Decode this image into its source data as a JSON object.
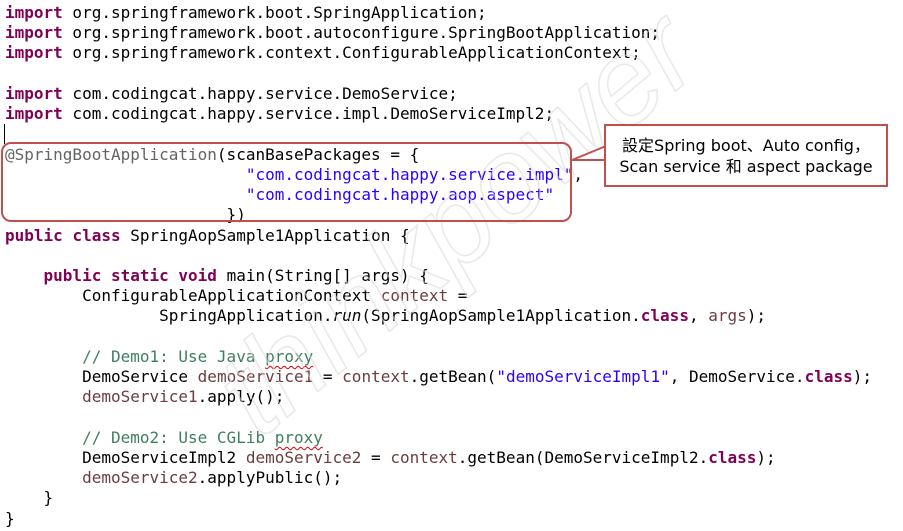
{
  "code": {
    "l1": {
      "kw": "import",
      "rest": " org.springframework.boot.SpringApplication;"
    },
    "l2": {
      "kw": "import",
      "rest": " org.springframework.boot.autoconfigure.SpringBootApplication;"
    },
    "l3": {
      "kw": "import",
      "rest": " org.springframework.context.ConfigurableApplicationContext;"
    },
    "l5": {
      "kw": "import",
      "rest": " com.codingcat.happy.service.DemoService;"
    },
    "l6": {
      "kw": "import",
      "rest": " com.codingcat.happy.service.impl.DemoServiceImpl2;"
    },
    "l8": {
      "ann": "@SpringBootApplication",
      "rest": "(scanBasePackages = {"
    },
    "l9": {
      "indent": "                         ",
      "str": "\"com.codingcat.happy.service.impl\"",
      "rest": ","
    },
    "l10": {
      "indent": "                         ",
      "str": "\"com.codingcat.happy.aop.aspect\""
    },
    "l11": {
      "text": "                       })"
    },
    "l12": {
      "kw1": "public",
      "sp": " ",
      "kw2": "class",
      "rest": " SpringAopSample1Application {"
    },
    "l14": {
      "indent": "    ",
      "kw1": "public",
      "kw2": "static",
      "kw3": "void",
      "rest": " main(String[] args) {"
    },
    "l15": {
      "indent": "        ",
      "type": "ConfigurableApplicationContext",
      "var": "context",
      "rest": " ="
    },
    "l16": {
      "indent": "                ",
      "pre": "SpringApplication.",
      "method": "run",
      "mid": "(SpringAopSample1Application.",
      "kw": "class",
      "post": ", ",
      "var": "args",
      "end": ");"
    },
    "l18": {
      "indent": "        ",
      "pre": "// Demo1: Use Java ",
      "sq": "proxy"
    },
    "l19": {
      "indent": "        ",
      "type": "DemoService",
      "var": "demoService1",
      "mid1": " = ",
      "var2": "context",
      "mid2": ".getBean(",
      "str": "\"demoServiceImpl1\"",
      "mid3": ", DemoService.",
      "kw": "class",
      "end": ");"
    },
    "l20": {
      "indent": "        ",
      "var": "demoService1",
      "rest": ".apply();"
    },
    "l22": {
      "indent": "        ",
      "pre": "// Demo2: Use CGLib ",
      "sq": "proxy"
    },
    "l23": {
      "indent": "        ",
      "type": "DemoServiceImpl2",
      "var": "demoService2",
      "mid1": " = ",
      "var2": "context",
      "mid2": ".getBean(DemoServiceImpl2.",
      "kw": "class",
      "end": ");"
    },
    "l24": {
      "indent": "        ",
      "var": "demoService2",
      "rest": ".applyPublic();"
    },
    "l25": {
      "text": "    }"
    },
    "l26": {
      "text": "}"
    }
  },
  "callout": {
    "line1": "設定Spring boot、Auto config，",
    "line2": "Scan service 和 aspect package"
  },
  "watermark": {
    "text": "thinkpower"
  },
  "colors": {
    "keyword": "#7f0055",
    "string": "#2a00ff",
    "annotation": "#646464",
    "comment": "#3f7f5f",
    "variable": "#6a3e3e",
    "highlight": "#c0504d"
  }
}
